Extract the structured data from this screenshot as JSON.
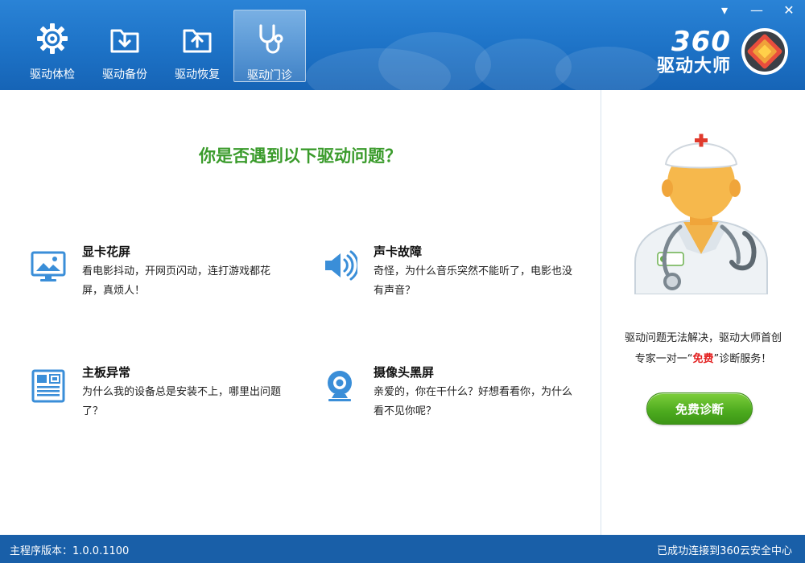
{
  "window": {
    "menu_glyph": "▾",
    "minimize_glyph": "—",
    "close_glyph": "✕"
  },
  "nav": {
    "items": [
      {
        "label": "驱动体检",
        "icon": "gear-icon"
      },
      {
        "label": "驱动备份",
        "icon": "backup-download-icon"
      },
      {
        "label": "驱动恢复",
        "icon": "restore-upload-icon"
      },
      {
        "label": "驱动门诊",
        "icon": "stethoscope-icon",
        "active": true
      }
    ]
  },
  "brand": {
    "number": "360",
    "name": "驱动大师",
    "logo_icon": "gpu-chip-icon"
  },
  "main": {
    "title": "你是否遇到以下驱动问题？",
    "issues": [
      {
        "title": "显卡花屏",
        "desc": "看电影抖动，开网页闪动，连打游戏都花屏，真烦人！",
        "icon": "monitor-image-icon"
      },
      {
        "title": "声卡故障",
        "desc": "奇怪，为什么音乐突然不能听了，电影也没有声音？",
        "icon": "speaker-icon"
      },
      {
        "title": "主板异常",
        "desc": "为什么我的设备总是安装不上，哪里出问题了？",
        "icon": "motherboard-icon"
      },
      {
        "title": "摄像头黑屏",
        "desc": "亲爱的，你在干什么？好想看看你，为什么看不见你呢？",
        "icon": "webcam-icon"
      }
    ]
  },
  "side": {
    "line1": "驱动问题无法解决，驱动大师首创",
    "line2_before": "专家一对一“",
    "line2_free": "免费",
    "line2_after": "”诊断服务！",
    "button_label": "免费诊断",
    "free_color": "#e32020"
  },
  "status": {
    "version": "主程序版本：1.0.0.1100",
    "connection": "已成功连接到360云安全中心"
  },
  "colors": {
    "header_blue": "#1d72c6",
    "title_green": "#3a9b2b",
    "button_green": "#4caa1e",
    "icon_blue": "#3a8ed8",
    "status_blue": "#195fa8"
  }
}
